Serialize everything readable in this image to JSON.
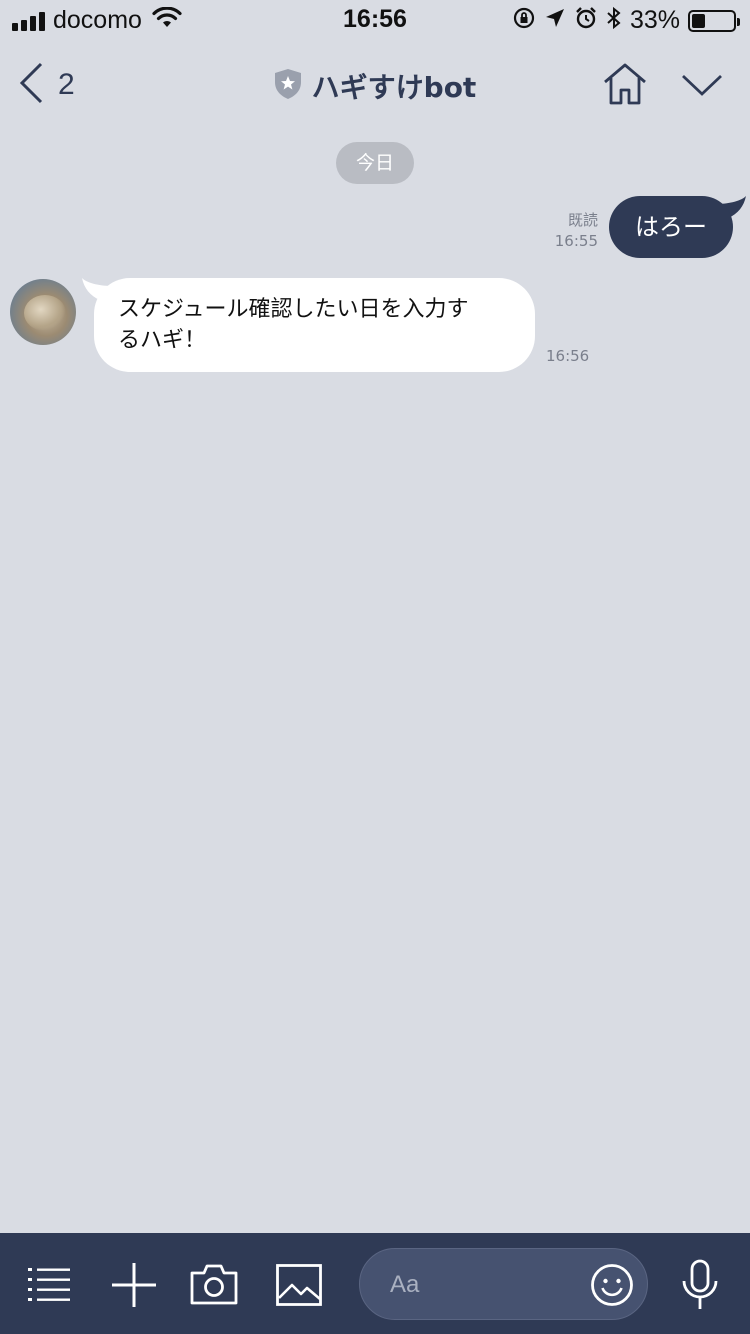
{
  "status_bar": {
    "carrier": "docomo",
    "time": "16:56",
    "battery_percent_text": "33%",
    "battery_level": 0.33
  },
  "header": {
    "back_count": "2",
    "title": "ハギすけbot"
  },
  "chat": {
    "date_label": "今日",
    "messages": [
      {
        "sender": "me",
        "text": "はろー",
        "read_label": "既読",
        "time": "16:55"
      },
      {
        "sender": "bot",
        "line1": "スケジュール確認したい日を入力す",
        "line2": "るハギ！",
        "time": "16:56"
      }
    ]
  },
  "input": {
    "placeholder": "Aa"
  },
  "colors": {
    "background": "#d9dce3",
    "navy": "#2f3a55",
    "bubble_in": "#ffffff"
  }
}
